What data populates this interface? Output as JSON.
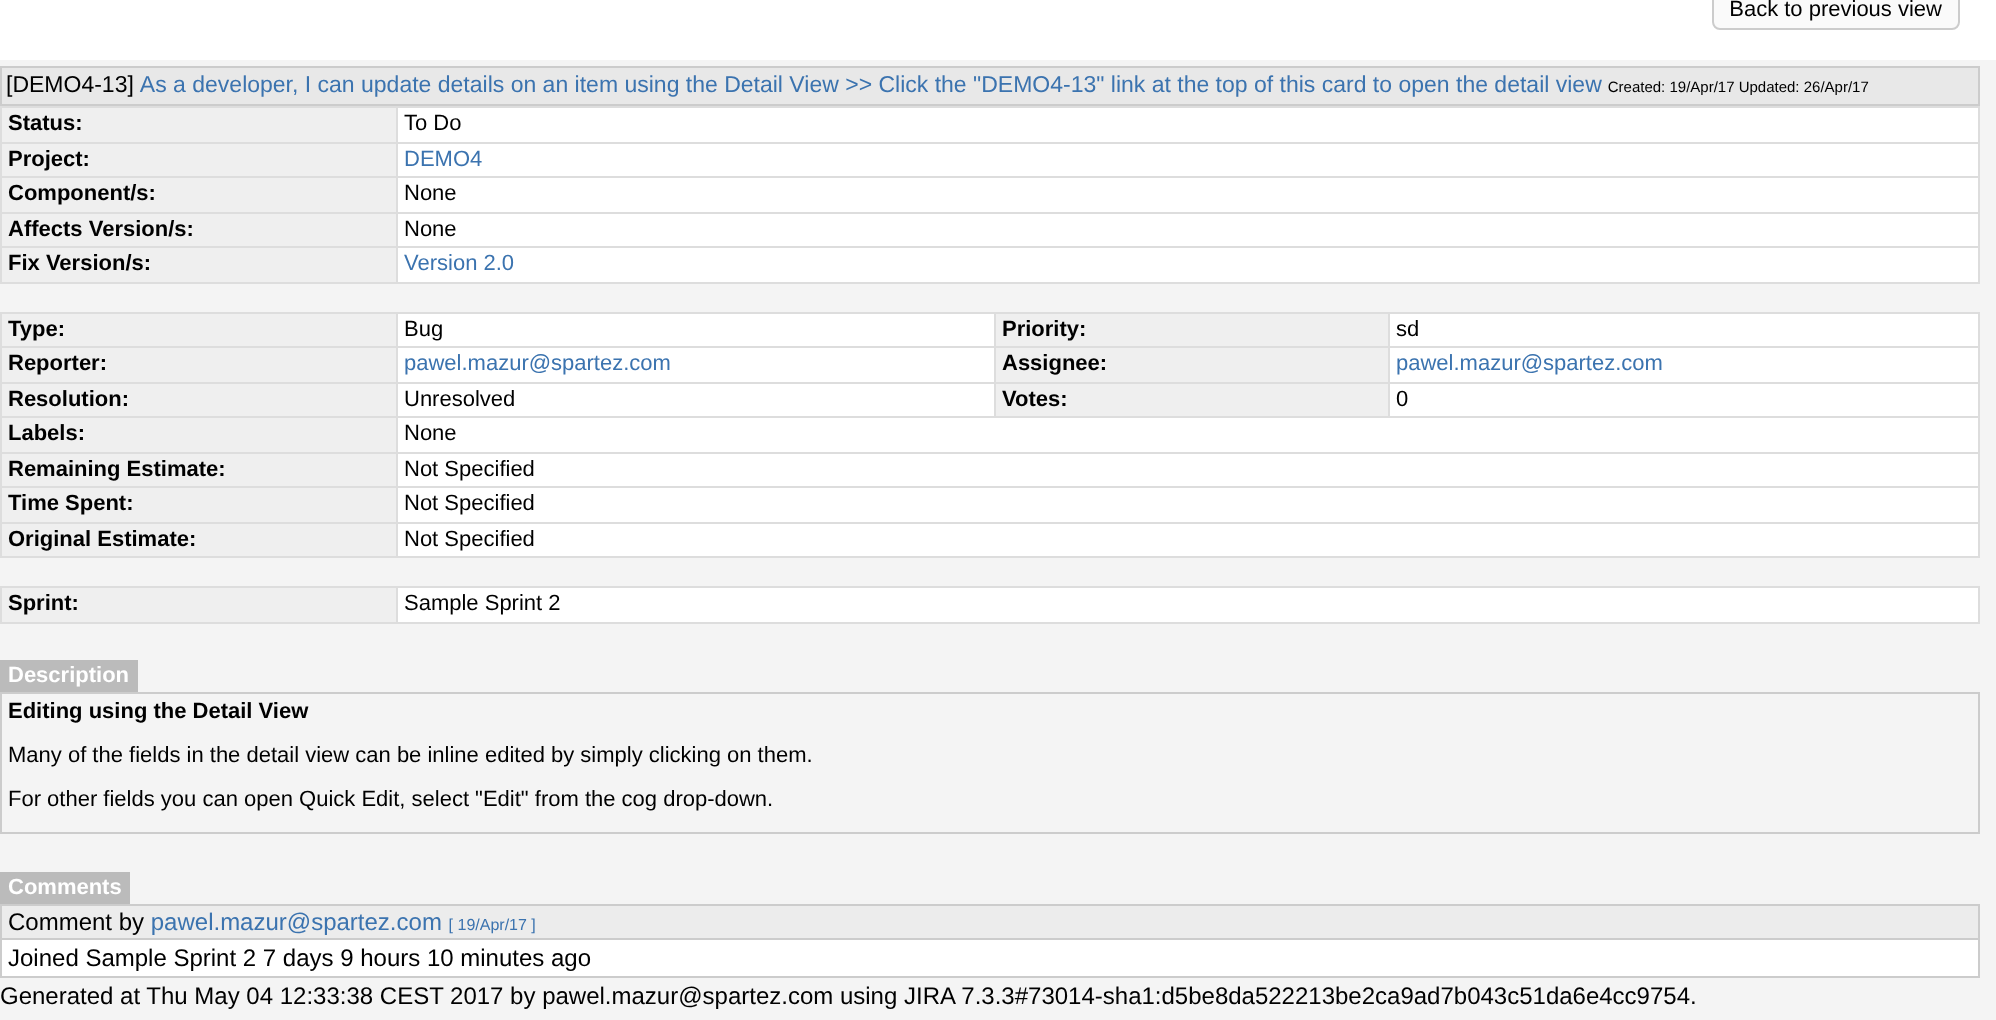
{
  "back_button": "Back to previous view",
  "issue": {
    "key": "[DEMO4-13]",
    "summary": "As a developer, I can update details on an item using the Detail View >> Click the \"DEMO4-13\" link at the top of this card to open the detail view",
    "dates": "Created: 19/Apr/17  Updated: 26/Apr/17"
  },
  "table_1": [
    {
      "label": "Status:",
      "value": "To Do",
      "link": false
    },
    {
      "label": "Project:",
      "value": "DEMO4",
      "link": true
    },
    {
      "label": "Component/s:",
      "value": "None",
      "link": false
    },
    {
      "label": "Affects Version/s:",
      "value": "None",
      "link": false
    },
    {
      "label": "Fix Version/s:",
      "value": "Version 2.0",
      "link": true
    }
  ],
  "table_2": [
    [
      {
        "label": "Type:",
        "value": "Bug",
        "link": false
      },
      {
        "label": "Priority:",
        "value": "sd",
        "link": false
      }
    ],
    [
      {
        "label": "Reporter:",
        "value": "pawel.mazur@spartez.com",
        "link": true
      },
      {
        "label": "Assignee:",
        "value": "pawel.mazur@spartez.com",
        "link": true
      }
    ],
    [
      {
        "label": "Resolution:",
        "value": "Unresolved",
        "link": false
      },
      {
        "label": "Votes:",
        "value": "0",
        "link": false
      }
    ],
    [
      {
        "label": "Labels:",
        "value": "None",
        "link": false
      }
    ],
    [
      {
        "label": "Remaining Estimate:",
        "value": "Not Specified",
        "link": false
      }
    ],
    [
      {
        "label": "Time Spent:",
        "value": "Not Specified",
        "link": false
      }
    ],
    [
      {
        "label": "Original Estimate:",
        "value": "Not Specified",
        "link": false
      }
    ]
  ],
  "table_3": [
    {
      "label": "Sprint:",
      "value": "Sample Sprint 2",
      "link": false
    }
  ],
  "description": {
    "tab": "Description",
    "heading": "Editing using the Detail View",
    "paragraphs": [
      "Many of the fields in the detail view can be inline edited by simply clicking on them.",
      "For other fields you can open Quick Edit, select \"Edit\" from the cog drop-down."
    ]
  },
  "comments": {
    "tab": "Comments",
    "items": [
      {
        "prefix": "Comment by",
        "author": "pawel.mazur@spartez.com",
        "date": "[ 19/Apr/17 ]",
        "body": "Joined Sample Sprint 2 7 days 9 hours 10 minutes ago"
      }
    ]
  },
  "footer": "Generated at Thu May 04 12:33:38 CEST 2017 by pawel.mazur@spartez.com using JIRA 7.3.3#73014-sha1:d5be8da522213be2ca9ad7b043c51da6e4cc9754."
}
